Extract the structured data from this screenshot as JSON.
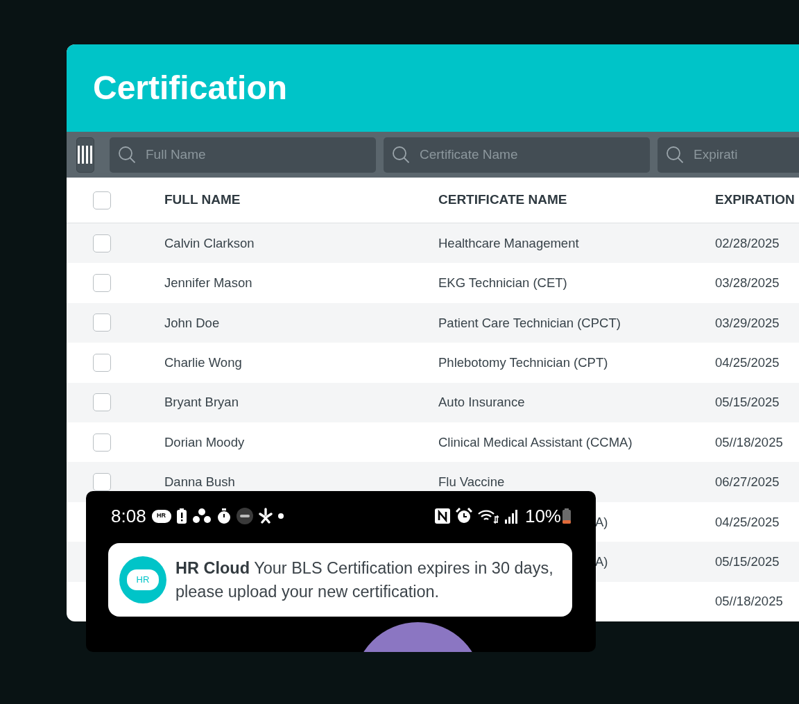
{
  "header": {
    "title": "Certification"
  },
  "toolbar": {
    "filters": [
      {
        "placeholder": "Full Name"
      },
      {
        "placeholder": "Certificate Name"
      },
      {
        "placeholder": "Expirati"
      }
    ]
  },
  "table": {
    "columns": [
      "FULL NAME",
      "CERTIFICATE NAME",
      "EXPIRATION"
    ],
    "all_checked": false,
    "rows": [
      {
        "kind": "full",
        "checked": false,
        "full_name": "Calvin Clarkson",
        "certificate_name": "Healthcare Management",
        "expiration": "02/28/2025"
      },
      {
        "kind": "full",
        "checked": false,
        "full_name": "Jennifer Mason",
        "certificate_name": "EKG Technician (CET)",
        "expiration": "03/28/2025"
      },
      {
        "kind": "full",
        "checked": false,
        "full_name": "John Doe",
        "certificate_name": "Patient Care Technician (CPCT)",
        "expiration": "03/29/2025"
      },
      {
        "kind": "full",
        "checked": false,
        "full_name": "Charlie Wong",
        "certificate_name": "Phlebotomy Technician (CPT)",
        "expiration": "04/25/2025"
      },
      {
        "kind": "full",
        "checked": false,
        "full_name": "Bryant Bryan",
        "certificate_name": "Auto Insurance",
        "expiration": "05/15/2025"
      },
      {
        "kind": "full",
        "checked": false,
        "full_name": "Dorian Moody",
        "certificate_name": "Clinical Medical Assistant (CCMA)",
        "expiration": "05//18/2025"
      },
      {
        "kind": "full",
        "checked": false,
        "full_name": "Danna Bush",
        "certificate_name": "Flu Vaccine",
        "expiration": "06/27/2025"
      },
      {
        "kind": "covered",
        "certificate_name": "A)",
        "expiration": "04/25/2025"
      },
      {
        "kind": "covered",
        "certificate_name": "A)",
        "expiration": "05/15/2025"
      },
      {
        "kind": "covered",
        "expiration": "05//18/2025"
      }
    ]
  },
  "phone": {
    "status_bar": {
      "time": "8:08",
      "app_badge": "HR",
      "battery": "10%"
    },
    "notification": {
      "icon_text": "HR",
      "message": "**HR Cloud** Your BLS Certification expires in 30 days, please upload your new certification."
    }
  }
}
